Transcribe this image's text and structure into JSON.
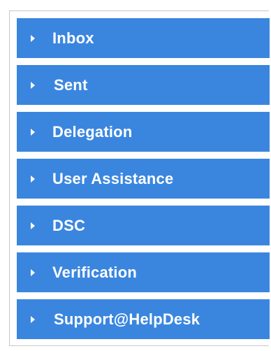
{
  "menu": {
    "items": [
      {
        "label": "Inbox",
        "icon": "caret-right-icon"
      },
      {
        "label": "Sent",
        "icon": "caret-right-icon"
      },
      {
        "label": "Delegation",
        "icon": "caret-right-icon"
      },
      {
        "label": "User Assistance",
        "icon": "caret-right-icon"
      },
      {
        "label": "DSC",
        "icon": "caret-right-icon"
      },
      {
        "label": "Verification",
        "icon": "caret-right-icon"
      },
      {
        "label": "Support@HelpDesk",
        "icon": "caret-right-icon"
      }
    ]
  },
  "colors": {
    "item_background": "#3a86df",
    "item_text": "#ffffff",
    "panel_border": "#c8c8c8"
  }
}
